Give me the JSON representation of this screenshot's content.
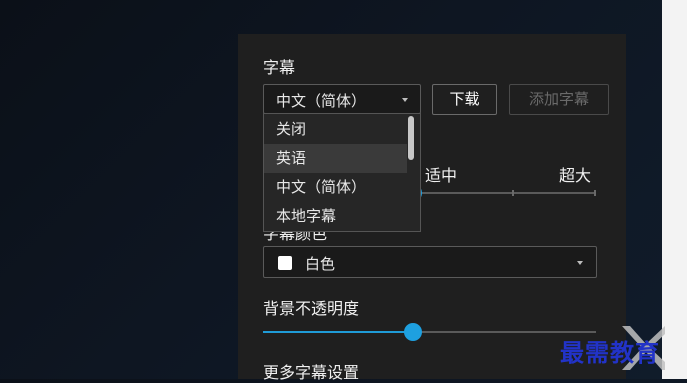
{
  "subtitle": {
    "heading": "字幕",
    "language_select": {
      "value": "中文（简体）"
    },
    "download_button": "下载",
    "add_subtitle_button": "添加字幕",
    "options": [
      "关闭",
      "英语",
      "中文（简体）",
      "本地字幕"
    ],
    "highlighted_option": "英语"
  },
  "font_size": {
    "mid_label": "适中",
    "max_label": "超大",
    "level": 0.45
  },
  "font_color": {
    "label": "字幕颜色",
    "value": "白色",
    "color": "#ffffff"
  },
  "background_opacity": {
    "label": "背景不透明度",
    "level": 0.45
  },
  "more": {
    "label": "更多字幕设置"
  },
  "watermark": "最需教育",
  "accent_color": "#1ea0e0"
}
